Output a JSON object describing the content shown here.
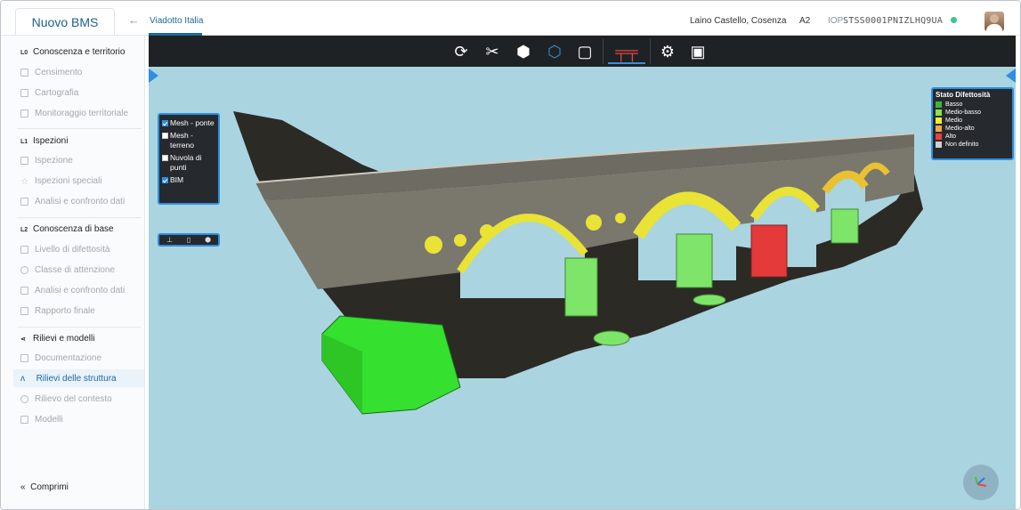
{
  "app": {
    "name": "Nuovo BMS"
  },
  "header": {
    "back_icon": "arrow-left-icon",
    "breadcrumb": "Viadotto Italia",
    "location": "Laino Castello, Cosenza",
    "region": "A2",
    "iop_label": "IOP",
    "iop_code": "STSS0001PNIZLHQ9UA",
    "status_color": "#3fc58a"
  },
  "sidebar": {
    "sections": [
      {
        "tag": "L0",
        "label": "Conoscenza e territorio",
        "items": [
          "Censimento",
          "Cartografia",
          "Monitoraggio territoriale"
        ]
      },
      {
        "tag": "L1",
        "label": "Ispezioni",
        "items": [
          "Ispezione",
          "Ispezioni speciali",
          "Analisi e confronto dati"
        ]
      },
      {
        "tag": "L2",
        "label": "Conoscenza di base",
        "items": [
          "Livello di difettosità",
          "Classe di attenzione",
          "Analisi e confronto dati",
          "Rapporto finale"
        ]
      },
      {
        "tag": "",
        "label": "Rilievi e modelli",
        "items": [
          "Documentazione",
          "Rilievi delle struttura",
          "Rilievo del contesto",
          "Modelli"
        ]
      }
    ],
    "active_item": "Rilievi delle struttura",
    "collapse_label": "Comprimi"
  },
  "viewer": {
    "toolbar": [
      "rotate-icon",
      "clip-icon",
      "cube-icon",
      "wire-cube-icon",
      "frame-icon",
      "bridge-icon",
      "settings-icon",
      "gallery-icon"
    ],
    "layers": [
      {
        "label": "Mesh - ponte",
        "checked": true
      },
      {
        "label": "Mesh - terreno",
        "checked": false
      },
      {
        "label": "Nuvola di punti",
        "checked": false
      },
      {
        "label": "BIM",
        "checked": true
      }
    ],
    "legend": {
      "title": "Stato Difettosità",
      "entries": [
        {
          "label": "Basso",
          "color": "#3db53a"
        },
        {
          "label": "Medio-basso",
          "color": "#8ee04a"
        },
        {
          "label": "Medio",
          "color": "#f2ee2a"
        },
        {
          "label": "Medio-alto",
          "color": "#f2a93a"
        },
        {
          "label": "Alto",
          "color": "#e84040"
        },
        {
          "label": "Non definito",
          "color": "#cfcfcf"
        }
      ]
    }
  }
}
